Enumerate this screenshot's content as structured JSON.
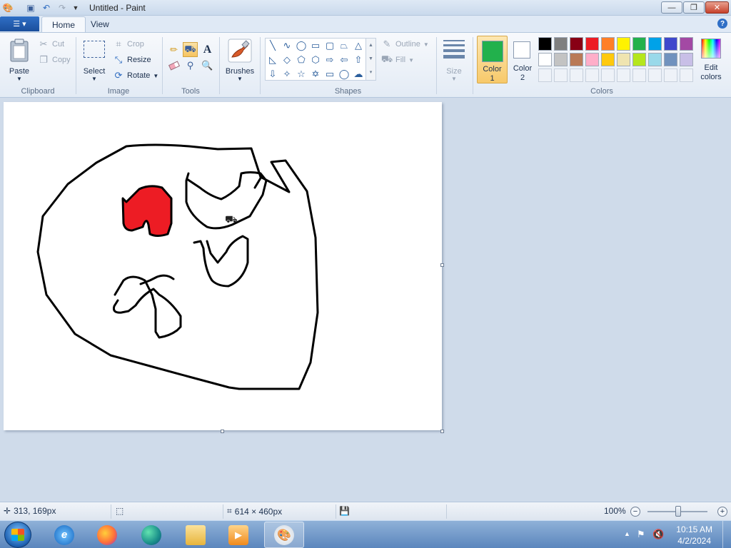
{
  "window": {
    "title": "Untitled - Paint",
    "minimize_glyph": "—",
    "maximize_glyph": "❐",
    "close_glyph": "✕"
  },
  "tabs": [
    {
      "label": "Home",
      "active": true
    },
    {
      "label": "View",
      "active": false
    }
  ],
  "help_glyph": "?",
  "ribbon": {
    "clipboard": {
      "label": "Clipboard",
      "paste": "Paste",
      "cut": "Cut",
      "copy": "Copy"
    },
    "image": {
      "label": "Image",
      "select": "Select",
      "crop": "Crop",
      "resize": "Resize",
      "rotate": "Rotate"
    },
    "tools": {
      "label": "Tools",
      "text_glyph": "A"
    },
    "brushes": {
      "label": "Brushes"
    },
    "shapes": {
      "label": "Shapes",
      "outline": "Outline",
      "fill": "Fill"
    },
    "size": {
      "label": "Size"
    },
    "colors": {
      "label": "Colors",
      "color1": "Color\n1",
      "color1_line1": "Color",
      "color1_line2": "1",
      "color2_line1": "Color",
      "color2_line2": "2",
      "edit_line1": "Edit",
      "edit_line2": "colors",
      "color1_value": "#22b14c",
      "color2_value": "#ffffff",
      "palette_row1": [
        "#000000",
        "#7f7f7f",
        "#880015",
        "#ed1c24",
        "#ff7f27",
        "#fff200",
        "#22b14c",
        "#00a2e8",
        "#3f48cc",
        "#a349a4"
      ],
      "palette_row2": [
        "#ffffff",
        "#c3c3c3",
        "#b97a57",
        "#ffaec9",
        "#ffc90e",
        "#efe4b0",
        "#b5e61d",
        "#99d9ea",
        "#7092be",
        "#c8bfe7"
      ]
    }
  },
  "status": {
    "cursor_pos": "313, 169px",
    "canvas_size": "614 × 460px",
    "zoom": "100%",
    "zoom_level": 100
  },
  "taskbar": {
    "time": "10:15 AM",
    "date": "4/2/2024"
  },
  "drawing": {
    "stroke_color": "#000000",
    "fill_color": "#ed1c24"
  }
}
